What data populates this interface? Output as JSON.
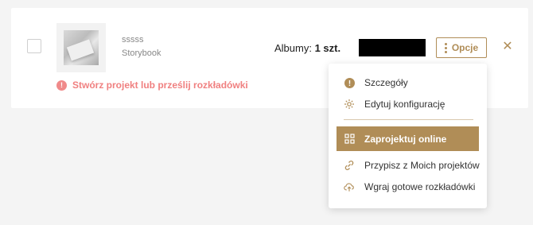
{
  "project": {
    "name": "sssss",
    "type": "Storybook",
    "albums_label": "Albumy:",
    "albums_value": "1 szt.",
    "options_label": "Opcje",
    "warning": "Stwórz projekt lub prześlij rozkładówki"
  },
  "menu": {
    "items": [
      {
        "label": "Szczegóły",
        "icon": "info-icon"
      },
      {
        "label": "Edytuj konfigurację",
        "icon": "gear-icon"
      },
      {
        "label": "Zaprojektuj online",
        "icon": "grid-icon",
        "active": true
      },
      {
        "label": "Przypisz z Moich projektów",
        "icon": "link-icon"
      },
      {
        "label": "Wgraj gotowe rozkładówki",
        "icon": "cloud-upload-icon"
      }
    ]
  },
  "colors": {
    "accent": "#b08d57",
    "warning": "#f08080"
  }
}
